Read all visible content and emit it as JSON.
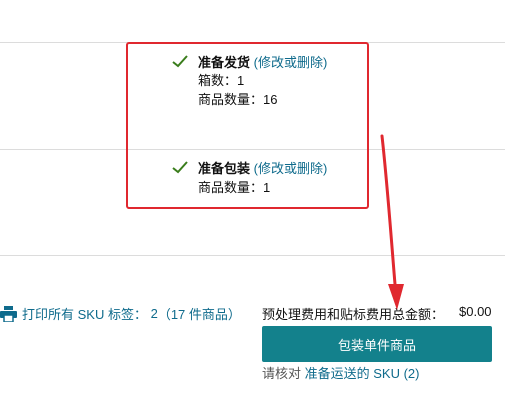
{
  "shipping_status": {
    "title": "准备发货",
    "edit_link": "(修改或删除)",
    "boxes_label": "箱数：",
    "boxes_value": "1",
    "quantity_label": "商品数量：",
    "quantity_value": "16"
  },
  "packing_status": {
    "title": "准备包装",
    "edit_link": "(修改或删除)",
    "quantity_label": "商品数量：",
    "quantity_value": "1"
  },
  "print": {
    "label": "打印所有 SKU 标签：",
    "count": "2",
    "detail": "（17 件商品）",
    "icon": "printer-icon"
  },
  "fee": {
    "label": "预处理费用和贴标费用总金额：",
    "amount": "$0.00"
  },
  "pack_button": {
    "label": "包装单件商品"
  },
  "review": {
    "prefix": "请核对",
    "link": "准备运送的 SKU (2)"
  },
  "colors": {
    "accent": "#13818c",
    "link": "#0f6b8c",
    "annotation": "#e0282f",
    "check": "#3a7d1c"
  }
}
